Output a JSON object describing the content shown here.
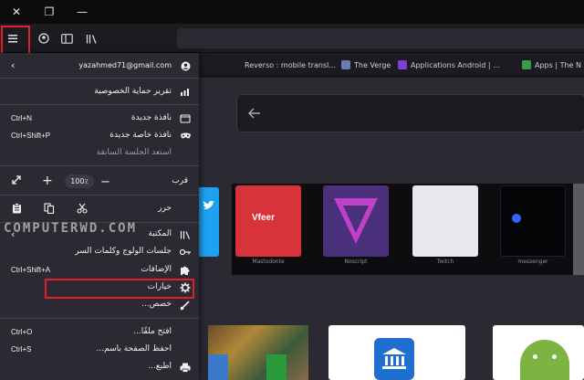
{
  "window": {
    "close": "✕",
    "restore": "❐",
    "minimize": "—"
  },
  "toolbar": {
    "menu_icon": "hamburger-icon",
    "account_icon": "account-icon",
    "sidebar_icon": "sidebar-icon",
    "library_icon": "library-icon"
  },
  "bookmarks": [
    {
      "label": "Reverso : mobile transl...",
      "color": "#6a7fb0"
    },
    {
      "label": "The Verge",
      "color": "#7b3fd6"
    },
    {
      "label": "Applications Android | ...",
      "color": "#3c9b4a"
    },
    {
      "label": "Apps | The N",
      "color": "#c23a3a"
    }
  ],
  "menu": {
    "account": "yazahmed71@gmail.com",
    "privacy_report": "تقرير حماية الخصوصية",
    "new_window": "نافذة جديدة",
    "new_window_sc": "Ctrl+N",
    "new_private_window": "نافذة خاصة جديدة",
    "new_private_window_sc": "Ctrl+Shift+P",
    "restore_session": "استعد الجلسة السابقة",
    "zoom_label": "قرب",
    "zoom_value": "100٪",
    "edit_label": "حرر",
    "library": "المكتبة",
    "logins": "جلسات الولوج وكلمات السر",
    "addons": "الإضافات",
    "addons_sc": "Ctrl+Shift+A",
    "options": "خيارات",
    "customize": "خصص...",
    "open_file": "افتح ملفًا...",
    "open_file_sc": "Ctrl+O",
    "save_page": "احفظ الصفحة باسم...",
    "save_page_sc": "Ctrl+S",
    "print": "اطبع..."
  },
  "tiles": [
    {
      "label": "Mastodonte",
      "color": "#d8323a"
    },
    {
      "label": "Noscript",
      "color": "#4a2f7a"
    },
    {
      "label": "Twitch",
      "color": "#e8e8ec"
    },
    {
      "label": "messenger",
      "color": "#050508"
    }
  ],
  "watermark": "COMPUTERWD.COM"
}
